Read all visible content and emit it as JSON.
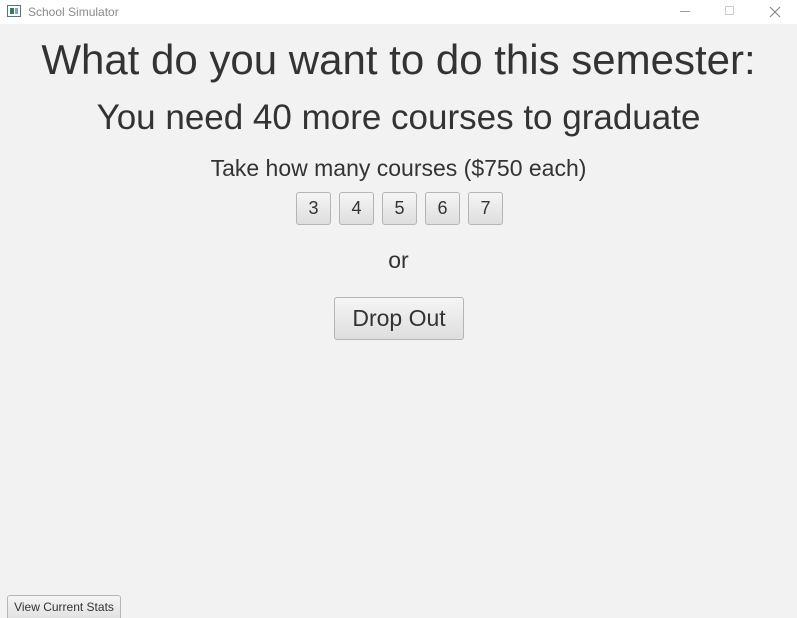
{
  "window": {
    "title": "School Simulator",
    "icon": "app-window-icon",
    "controls": [
      "minimize-icon",
      "maximize-icon",
      "close-icon"
    ]
  },
  "main": {
    "heading": "What do you want to do this semester:",
    "remaining_text": "You need 40 more courses to graduate",
    "courses_prompt": "Take how many courses ($750 each)",
    "course_options": [
      "3",
      "4",
      "5",
      "6",
      "7"
    ],
    "or_text": "or",
    "drop_out_label": "Drop Out"
  },
  "footer": {
    "stats_label": "View Current Stats"
  }
}
